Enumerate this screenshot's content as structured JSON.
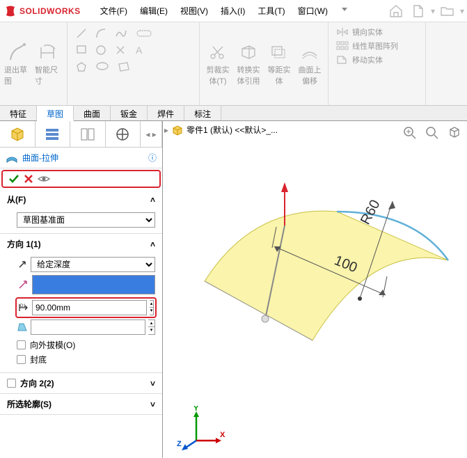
{
  "app": {
    "logo_text": "SOLIDWORKS"
  },
  "menu": [
    "文件(F)",
    "编辑(E)",
    "视图(V)",
    "插入(I)",
    "工具(T)",
    "窗口(W)"
  ],
  "ribbon": {
    "exit_sketch": "退出草图",
    "smart_dim": "智能尺寸",
    "trim": "剪裁实体(T)",
    "convert": "转换实体引用",
    "offset": "等距实体",
    "surface_offset": "曲面上偏移",
    "mirror": "镜向实体",
    "linear_pattern": "线性草图阵列",
    "move": "移动实体"
  },
  "cmd_tabs": [
    "特征",
    "草图",
    "曲面",
    "钣金",
    "焊件",
    "标注"
  ],
  "breadcrumb": "零件1 (默认) <<默认>_...",
  "feature": {
    "title": "曲面-拉伸",
    "from_label": "从(F)",
    "from_value": "草图基准面",
    "dir1_label": "方向 1(1)",
    "dir1_type": "给定深度",
    "depth_value": "90.00mm",
    "draft_out": "向外拔模(O)",
    "cap": "封底",
    "dir2_label": "方向 2(2)",
    "sel_contour": "所选轮廓(S)"
  },
  "chart_data": {
    "type": "cad_sketch",
    "dimensions": {
      "radius": "R60",
      "length": "100"
    },
    "triad_labels": {
      "x": "X",
      "y": "Y",
      "z": "Z"
    }
  }
}
